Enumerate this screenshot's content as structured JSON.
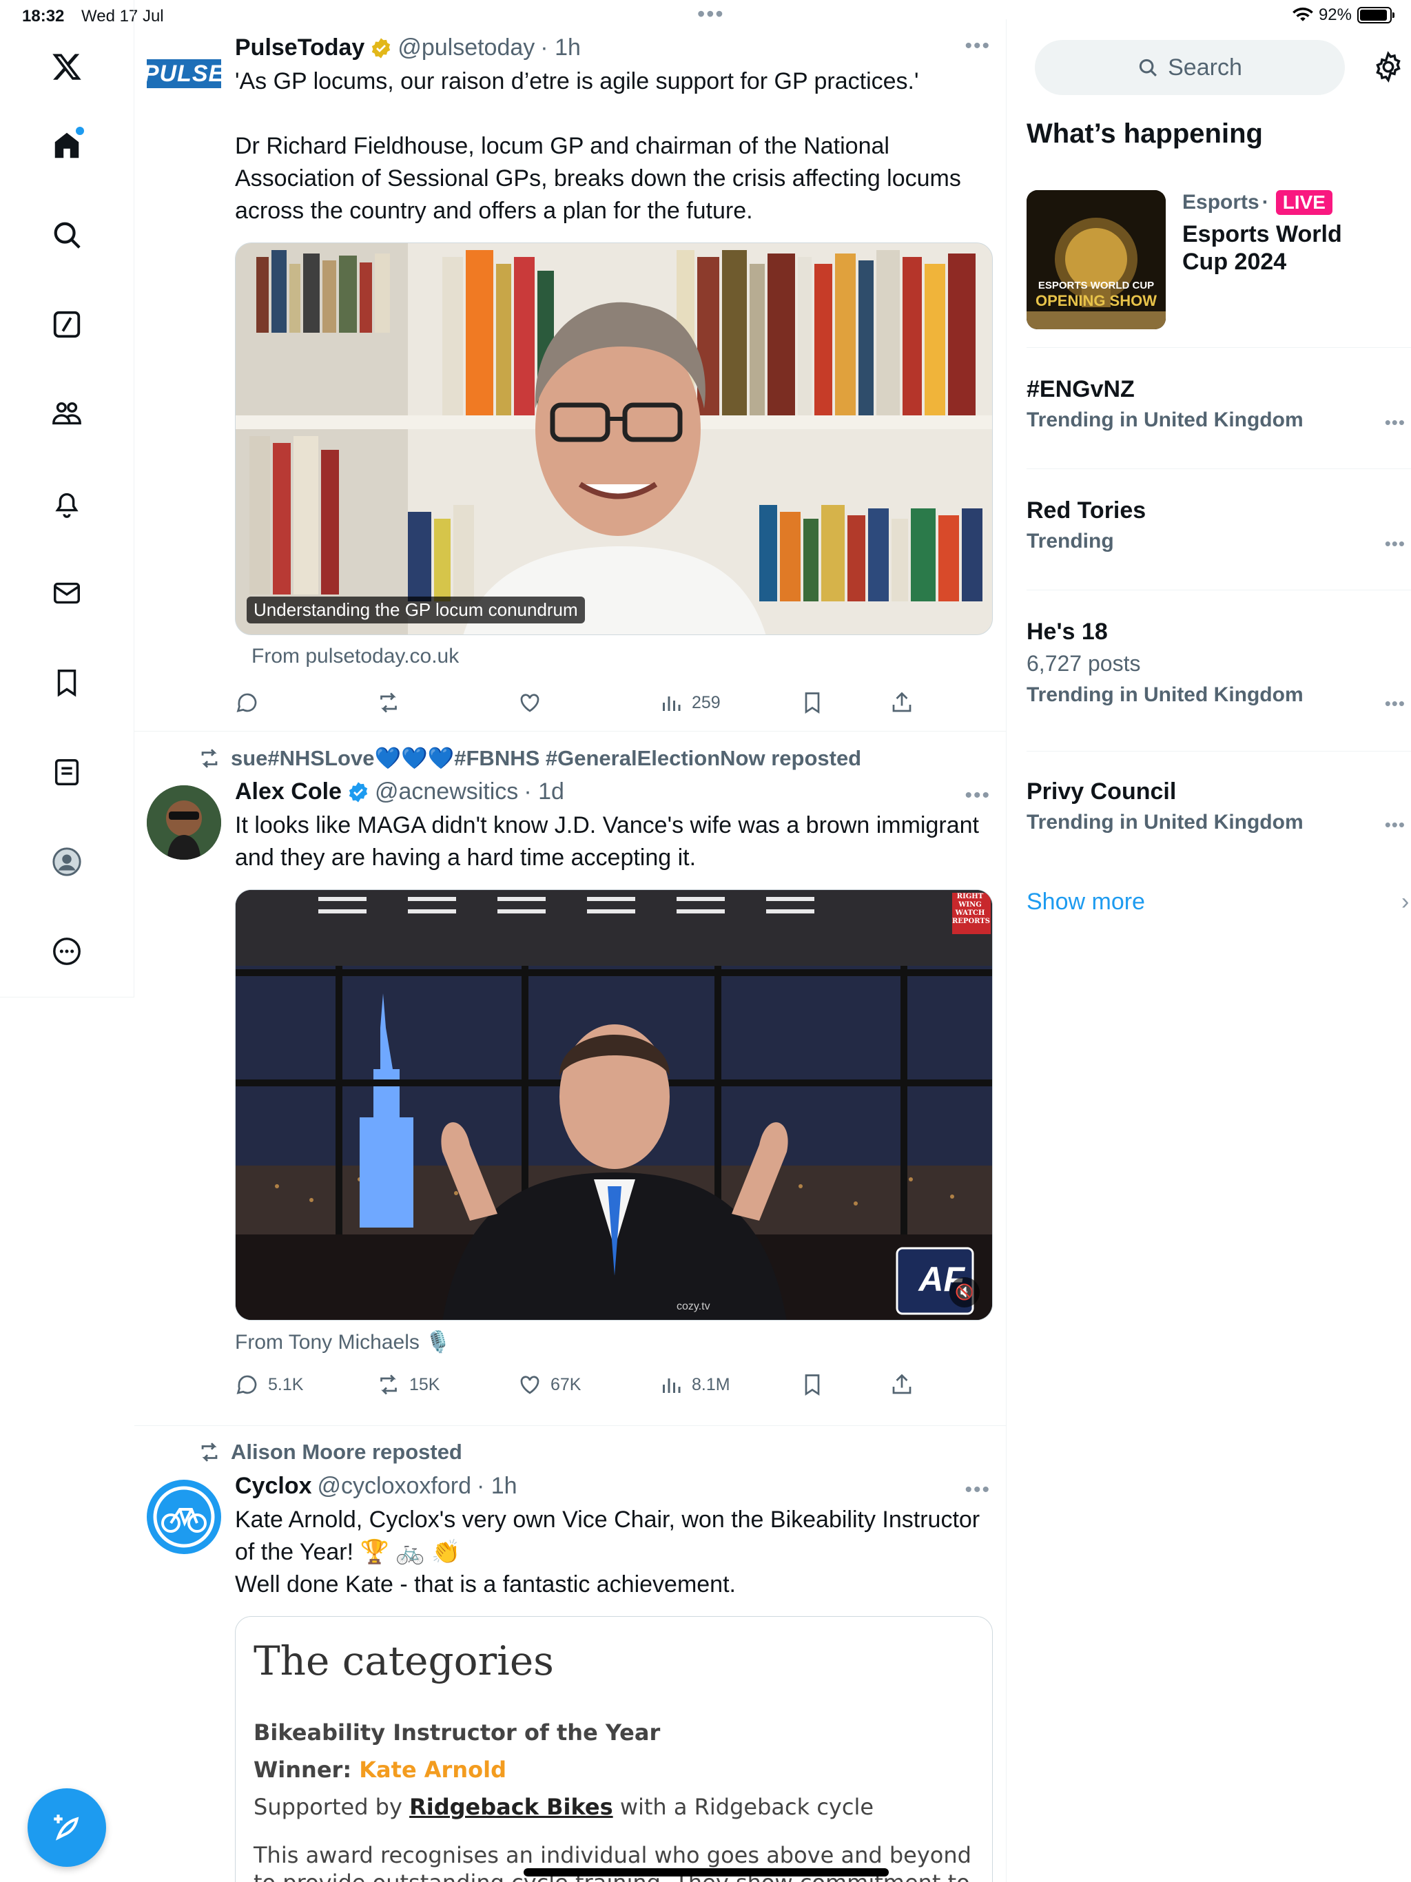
{
  "status_bar": {
    "time": "18:32",
    "date": "Wed 17 Jul",
    "battery": "92%"
  },
  "nav": {
    "items": [
      "x-logo-icon",
      "home-icon",
      "search-icon",
      "grok-icon",
      "communities-icon",
      "notifications-icon",
      "messages-icon",
      "bookmarks-icon",
      "lists-icon",
      "profile-icon",
      "more-icon"
    ]
  },
  "feed": {
    "tweets": [
      {
        "avatar_label": "PULSE",
        "name": "PulseToday",
        "handle": "@pulsetoday",
        "time": "· 1h",
        "text": "'As GP locums, our raison d’etre is agile support for GP practices.'\n\nDr Richard Fieldhouse, locum GP and chairman of the National Association of Sessional GPs, breaks down the crisis affecting locums across the country and offers a plan for the future.",
        "media_caption": "Understanding the GP locum conundrum",
        "from": "From pulsetoday.co.uk",
        "stats": {
          "replies": "",
          "reposts": "",
          "likes": "",
          "views": "259"
        }
      },
      {
        "repost_by": "sue#NHSLove💙💙💙#FBNHS #GeneralElectionNow reposted",
        "name": "Alex Cole",
        "handle": "@acnewsitics",
        "time": "· 1d",
        "text": "It looks like MAGA didn't know J.D. Vance's wife was a brown immigrant and they are having a hard time accepting it.",
        "media_badge": "RIGHT WING WATCH REPORTS",
        "media_logo": "AF",
        "media_watermark": "cozy.tv",
        "from": "From Tony Michaels 🎙️",
        "stats": {
          "replies": "5.1K",
          "reposts": "15K",
          "likes": "67K",
          "views": "8.1M"
        }
      },
      {
        "repost_by": "Alison Moore reposted",
        "name": "Cyclox",
        "handle": "@cycloxoxford",
        "time": "· 1h",
        "text": "Kate Arnold, Cyclox's very own Vice Chair, won the Bikeability Instructor of the Year! 🏆 🚲 👏\nWell done Kate - that is a fantastic achievement.",
        "card": {
          "title": "The categories",
          "award": "Bikeability Instructor of the Year",
          "winner_label": "Winner:",
          "winner": "Kate Arnold",
          "supported_prefix": "Supported by",
          "sponsor": "Ridgeback Bikes",
          "supported_suffix": "with a Ridgeback cycle",
          "body": "This award recognises an individual who goes above and beyond to provide outstanding cycle training. They show commitment to ensuring"
        }
      }
    ]
  },
  "sidebar": {
    "search_placeholder": "Search",
    "heading": "What’s happening",
    "featured": {
      "category": "Esports",
      "live": "LIVE",
      "title": "Esports World Cup 2024",
      "image_text": "ESPORTS WORLD CUP",
      "image_sub": "OPENING SHOW"
    },
    "trends": [
      {
        "title": "#ENGvNZ",
        "meta": "Trending in United Kingdom",
        "count": ""
      },
      {
        "title": "Red Tories",
        "meta": "Trending",
        "count": ""
      },
      {
        "title": "He's 18",
        "meta": "Trending in United Kingdom",
        "count": "6,727 posts"
      },
      {
        "title": "Privy Council",
        "meta": "Trending in United Kingdom",
        "count": ""
      }
    ],
    "show_more": "Show more"
  },
  "colors": {
    "accent": "#1d9bf0",
    "live": "#f91880",
    "verified_gold": "#e2b719"
  }
}
